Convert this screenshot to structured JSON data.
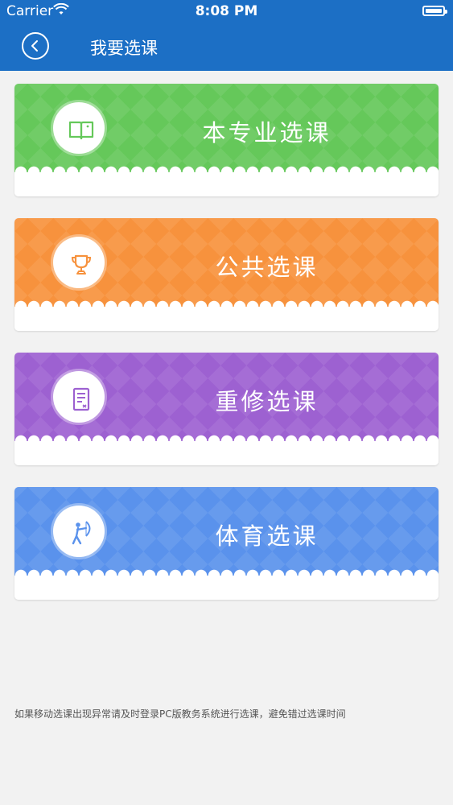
{
  "status_bar": {
    "carrier": "Carrier",
    "time": "8:08 PM"
  },
  "nav": {
    "back_icon": "chevron-left-icon",
    "title": "我要选课"
  },
  "courses": [
    {
      "label": "本专业选课",
      "icon": "book-icon",
      "color": "#65c85a"
    },
    {
      "label": "公共选课",
      "icon": "trophy-icon",
      "color": "#f7923d"
    },
    {
      "label": "重修选课",
      "icon": "document-icon",
      "color": "#9d61d1"
    },
    {
      "label": "体育选课",
      "icon": "archer-icon",
      "color": "#5a92ec"
    }
  ],
  "footer": {
    "note": "如果移动选课出现异常请及时登录PC版教务系统进行选课，避免错过选课时间"
  },
  "colors": {
    "nav_bar": "#1c6fc5",
    "background": "#f2f2f2"
  }
}
